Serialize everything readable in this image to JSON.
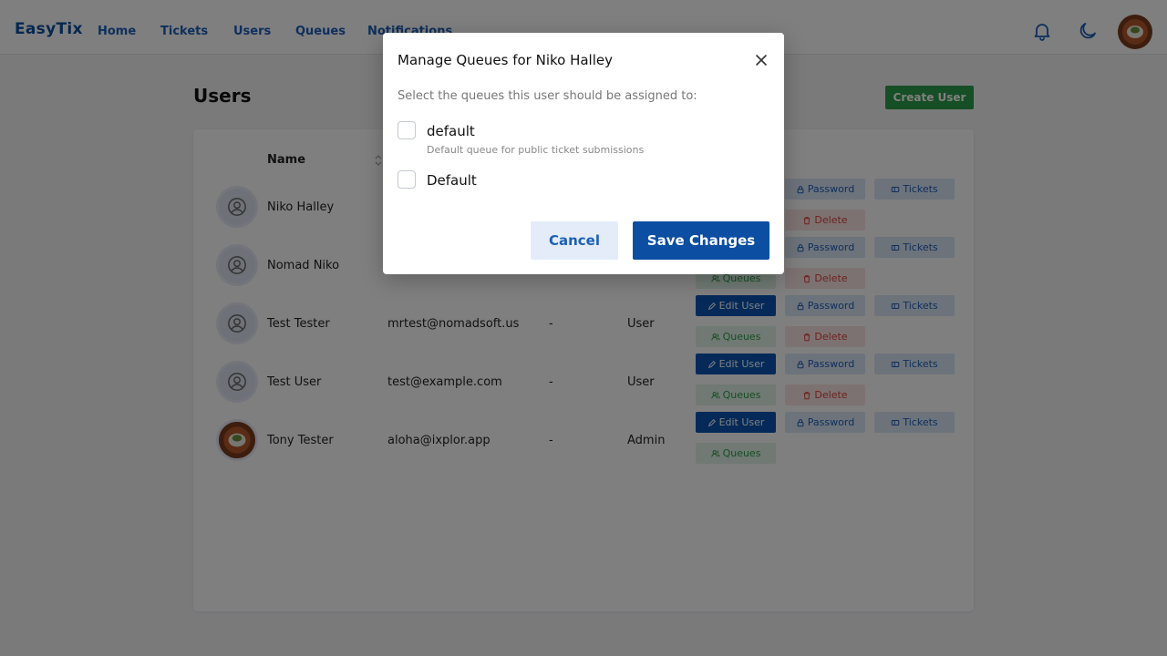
{
  "nav": {
    "brand": "EasyTix",
    "links": [
      "Home",
      "Tickets",
      "Users",
      "Queues",
      "Notifications"
    ]
  },
  "page": {
    "title": "Users",
    "create_label": "Create User"
  },
  "table": {
    "name_header": "Name",
    "actions": {
      "edit": "Edit User",
      "password": "Password",
      "tickets": "Tickets",
      "queues": "Queues",
      "delete": "Delete"
    },
    "rows": [
      {
        "name": "Niko Halley",
        "email": "",
        "dash": "",
        "role": ""
      },
      {
        "name": "Nomad Niko",
        "email": "",
        "dash": "",
        "role": ""
      },
      {
        "name": "Test Tester",
        "email": "mrtest@nomadsoft.us",
        "dash": "-",
        "role": "User"
      },
      {
        "name": "Test User",
        "email": "test@example.com",
        "dash": "-",
        "role": "User"
      },
      {
        "name": "Tony Tester",
        "email": "aloha@ixplor.app",
        "dash": "-",
        "role": "Admin"
      }
    ]
  },
  "modal": {
    "title": "Manage Queues for Niko Halley",
    "hint": "Select the queues this user should be assigned to:",
    "queues": [
      {
        "label": "default",
        "description": "Default queue for public ticket submissions",
        "checked": false
      },
      {
        "label": "Default",
        "description": "",
        "checked": false
      }
    ],
    "cancel_label": "Cancel",
    "save_label": "Save Changes"
  },
  "colors": {
    "primary": "#0b4ea2",
    "success": "#2d9d4a",
    "danger": "#d9443a"
  },
  "icons": [
    "bell-icon",
    "moon-icon",
    "close-icon",
    "sort-icon",
    "user-circle-icon",
    "edit-icon",
    "lock-icon",
    "ticket-icon",
    "users-icon",
    "trash-icon"
  ]
}
